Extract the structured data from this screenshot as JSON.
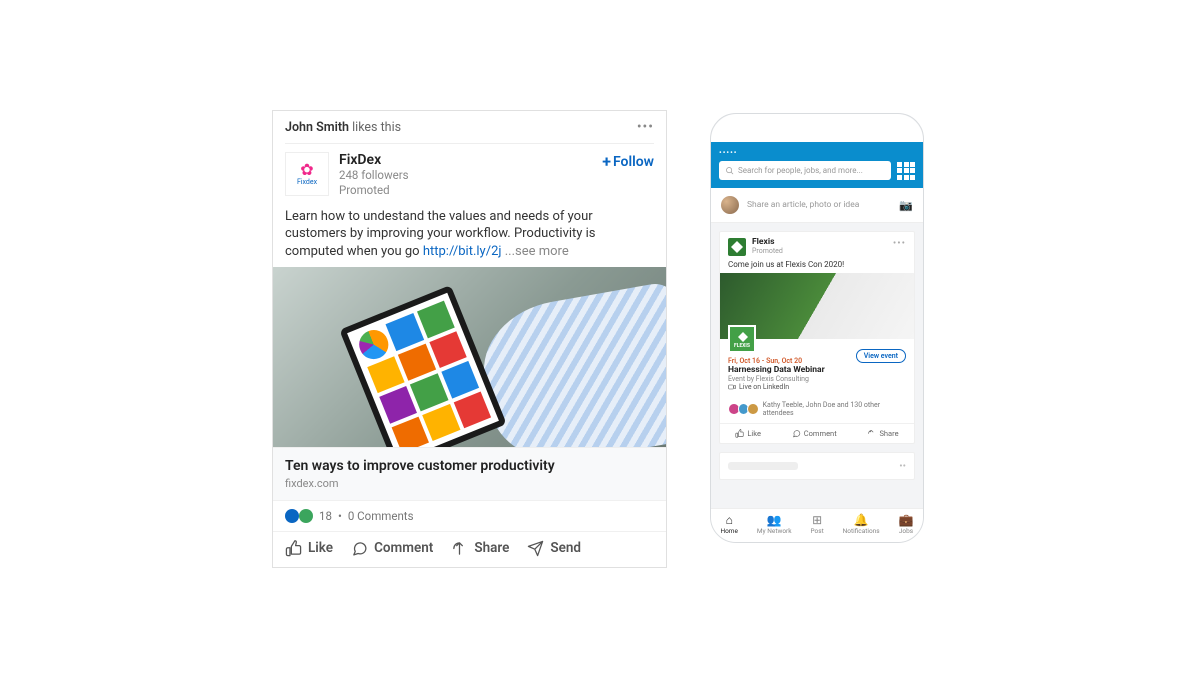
{
  "desktop_post": {
    "social_proof_name": "John Smith",
    "social_proof_suffix": "likes this",
    "entity": {
      "name": "FixDex",
      "followers": "248 followers",
      "promoted": "Promoted",
      "logo_text": "Fixdex"
    },
    "follow_label": "Follow",
    "body_text": "Learn how to undestand the values and needs of your customers by improving your workflow. Productivity is computed when you go ",
    "body_link": "http://bit.ly/2j",
    "see_more": "...see more",
    "article": {
      "title": "Ten ways to improve customer productivity",
      "domain": "fixdex.com"
    },
    "social": {
      "count": "18",
      "separator": "•",
      "comments": "0 Comments"
    },
    "actions": {
      "like": "Like",
      "comment": "Comment",
      "share": "Share",
      "send": "Send"
    }
  },
  "mobile": {
    "search_placeholder": "Search for people, jobs, and more...",
    "composer_placeholder": "Share an article, photo or idea",
    "post": {
      "company": "Flexis",
      "promoted": "Promoted",
      "logo_text": "FLEXIS",
      "body": "Come join us at Flexis Con 2020!",
      "event": {
        "date": "Fri, Oct 16 - Sun, Oct 20",
        "title": "Harnessing Data Webinar",
        "subtitle": "Event by Flexis Consulting",
        "live_label": "Live on LinkedIn",
        "view_label": "View event",
        "attendees_text": "Kathy Teeble, John Doe and 130 other attendees"
      },
      "actions": {
        "like": "Like",
        "comment": "Comment",
        "share": "Share"
      }
    },
    "tabs": {
      "home": "Home",
      "network": "My Network",
      "post": "Post",
      "notifications": "Notifications",
      "jobs": "Jobs"
    }
  }
}
